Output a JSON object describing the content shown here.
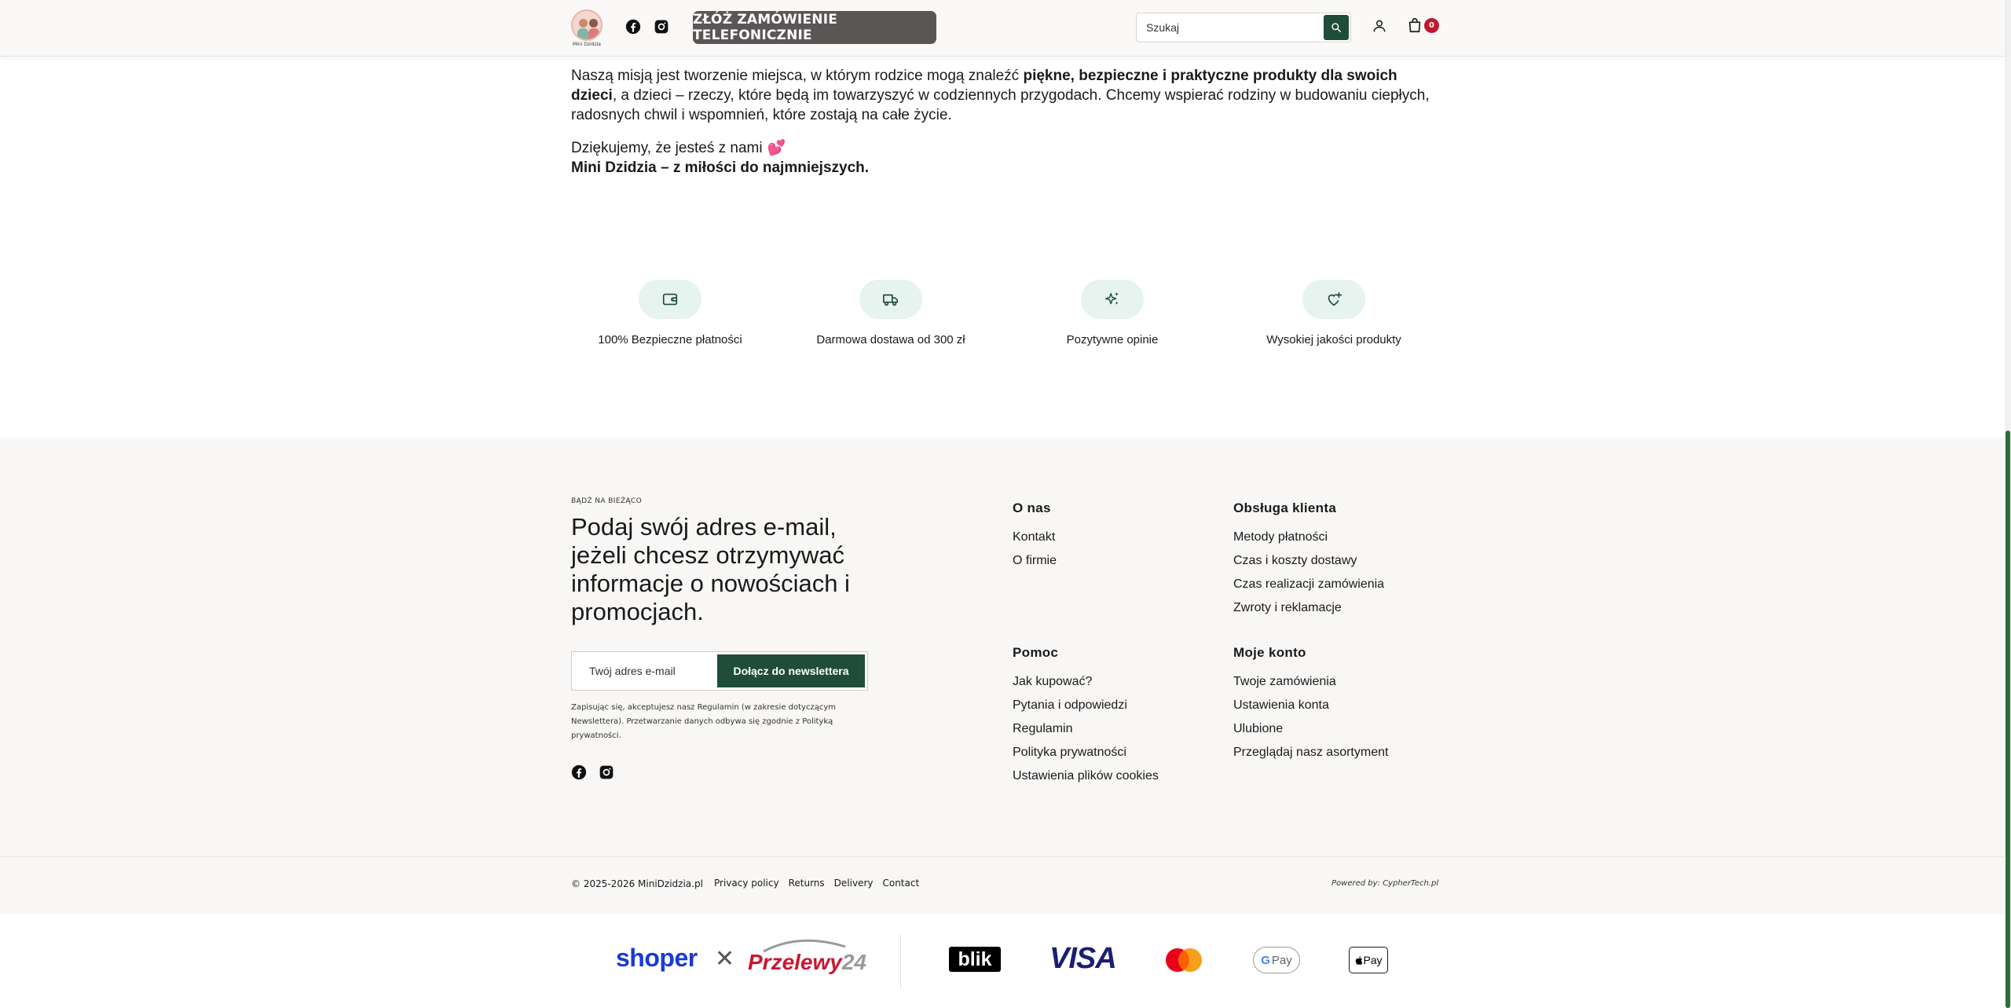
{
  "header": {
    "logo_caption": "Mini Dzidzia",
    "phone_order_label": "ZŁÓŻ ZAMÓWIENIE TELEFONICZNIE",
    "search_placeholder": "Szukaj",
    "cart_count": "0",
    "icons": [
      "facebook-icon",
      "instagram-icon",
      "search-icon",
      "user-icon",
      "cart-icon"
    ]
  },
  "article": {
    "p1_start": "Naszą misją jest tworzenie miejsca, w którym rodzice mogą znaleźć ",
    "p1_bold": "piękne, bezpieczne i praktyczne produkty dla swoich dzieci",
    "p1_end": ", a dzieci – rzeczy, które będą im towarzyszyć w codziennych przygodach. Chcemy wspierać rodziny w budowaniu ciepłych, radosnych chwil i wspomnień, które zostają na całe życie.",
    "thanks": "Dziękujemy, że jesteś z nami",
    "thanks_emoji": "💕",
    "signature": "Mini Dzidzia – z miłości do najmniejszych."
  },
  "features": [
    {
      "label": "100% Bezpieczne płatności",
      "icon": "wallet-icon"
    },
    {
      "label": "Darmowa dostawa od 300 zł",
      "icon": "truck-icon"
    },
    {
      "label": "Pozytywne opinie",
      "icon": "sparkles-icon"
    },
    {
      "label": "Wysokiej jakości produkty",
      "icon": "heart-plus-icon"
    }
  ],
  "footer": {
    "newsletter": {
      "kicker": "BĄDŹ NA BIEŻĄCO",
      "title": "Podaj swój adres e-mail, jeżeli chcesz otrzymywać informacje o nowościach i promocjach.",
      "email_placeholder": "Twój adres e-mail",
      "button": "Dołącz do newslettera",
      "note": "Zapisując się, akceptujesz nasz Regulamin (w zakresie dotyczącym Newslettera). Przetwarzanie danych odbywa się zgodnie z Polityką prywatności."
    },
    "columns": [
      {
        "title": "O nas",
        "links": [
          "Kontakt",
          "O firmie"
        ]
      },
      {
        "title": "Obsługa klienta",
        "links": [
          "Metody płatności",
          "Czas i koszty dostawy",
          "Czas realizacji zamówienia",
          "Zwroty i reklamacje"
        ]
      },
      {
        "title": "Pomoc",
        "links": [
          "Jak kupować?",
          "Pytania i odpowiedzi",
          "Regulamin",
          "Polityka prywatności",
          "Ustawienia plików cookies"
        ]
      },
      {
        "title": "Moje konto",
        "links": [
          "Twoje zamówienia",
          "Ustawienia konta",
          "Ulubione",
          "Przeglądaj nasz asortyment"
        ]
      }
    ],
    "copyright": "© 2025-2026 MiniDzidzia.pl",
    "bottom_links": [
      "Privacy policy",
      "Returns",
      "Delivery",
      "Contact"
    ],
    "powered_by": "Powered by: CypherTech.pl"
  },
  "payments": {
    "shoper": "shoper",
    "cross": "✕",
    "przelewy": "Przelewy",
    "przelewy_num": "24",
    "blik": "blik",
    "visa": "VISA",
    "gpay_g": "G",
    "gpay": "Pay",
    "applepay": " Pay"
  },
  "colors": {
    "brand_green": "#1f4d3a",
    "phone_button": "#5a5655",
    "badge_red": "#c0182c",
    "feature_pill": "#e6f3ee"
  }
}
